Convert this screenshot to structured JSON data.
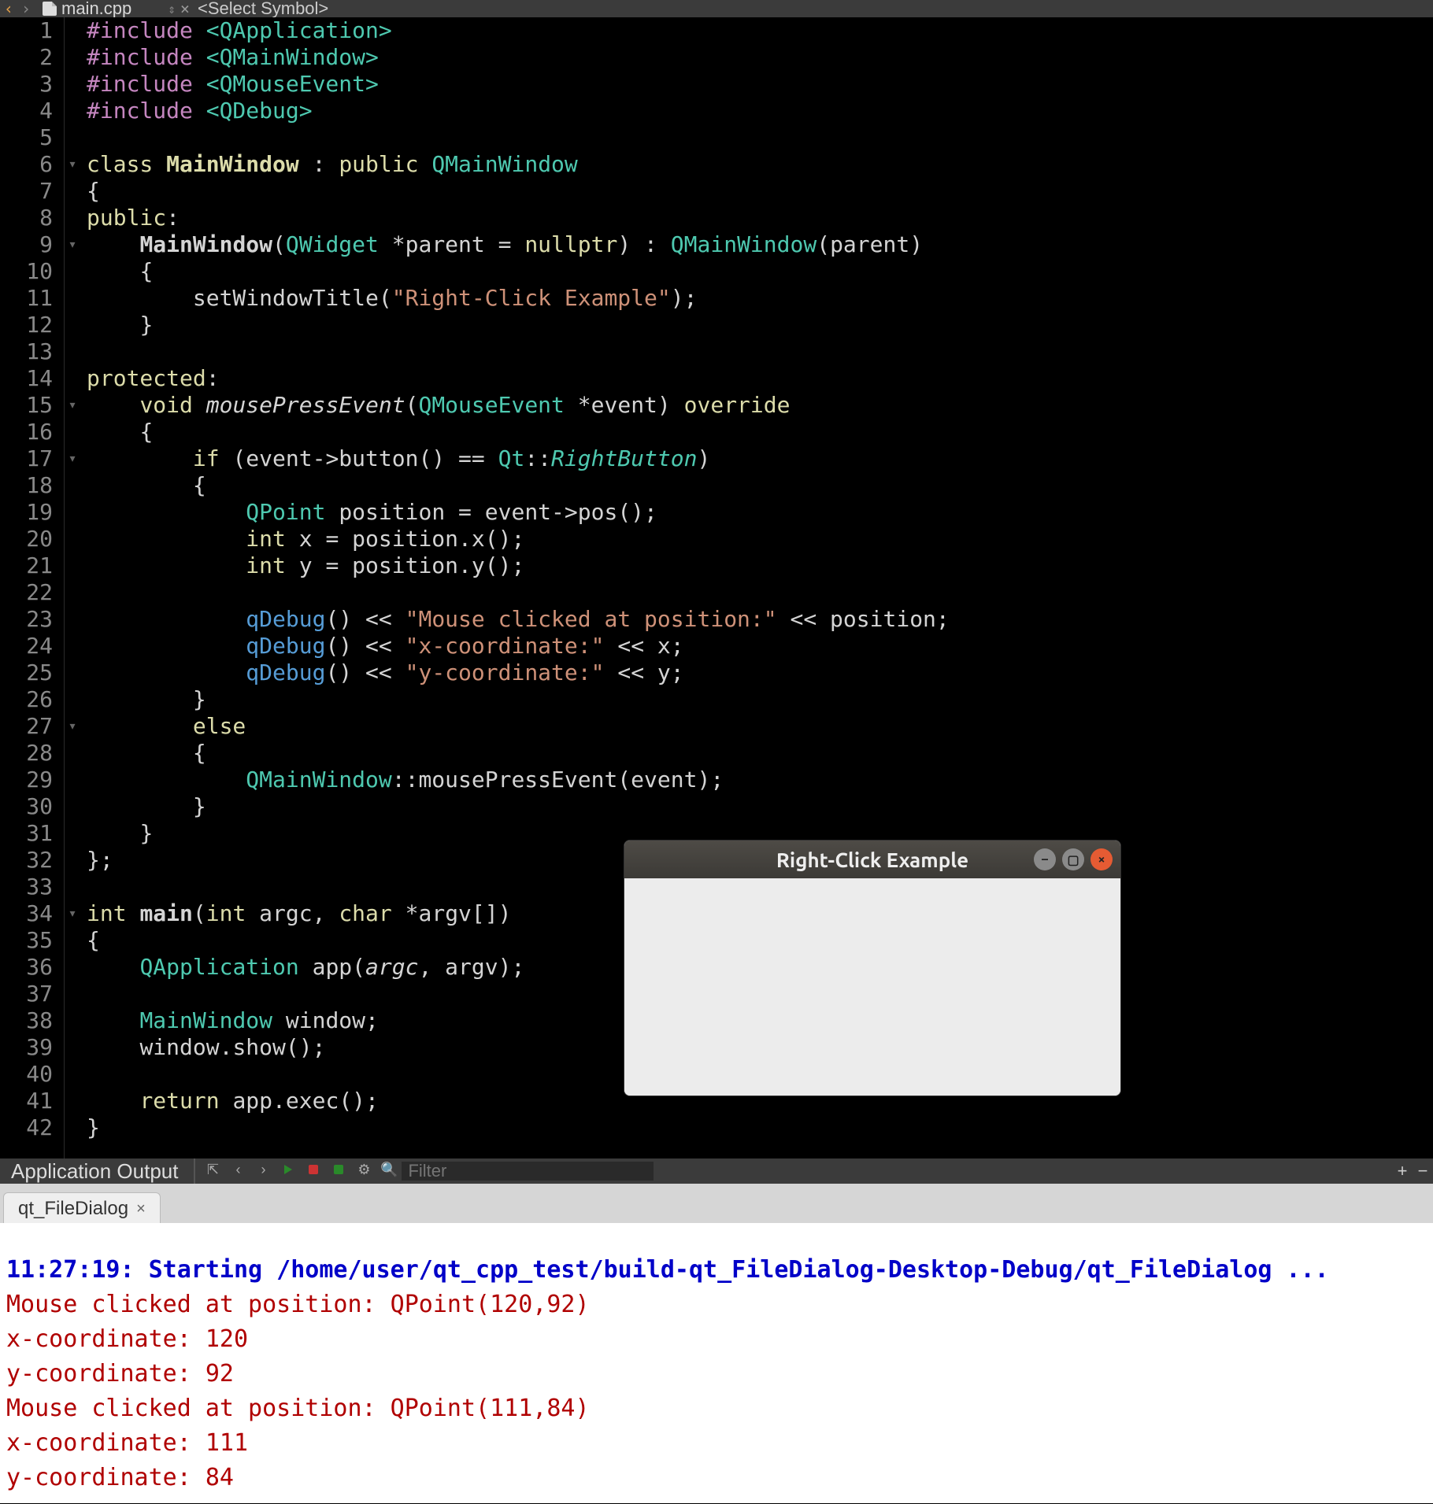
{
  "topbar": {
    "filename": "main.cpp",
    "symbol_selector": "<Select Symbol>"
  },
  "code_lines": [
    {
      "n": 1,
      "fold": "",
      "html": "<span class='kw-purple'>#include</span> <span class='hdr'>&lt;QApplication&gt;</span>"
    },
    {
      "n": 2,
      "fold": "",
      "html": "<span class='kw-purple'>#include</span> <span class='hdr'>&lt;QMainWindow&gt;</span>"
    },
    {
      "n": 3,
      "fold": "",
      "html": "<span class='kw-purple'>#include</span> <span class='hdr'>&lt;QMouseEvent&gt;</span>"
    },
    {
      "n": 4,
      "fold": "",
      "html": "<span class='kw-purple'>#include</span> <span class='hdr'>&lt;QDebug&gt;</span>"
    },
    {
      "n": 5,
      "fold": "",
      "html": ""
    },
    {
      "n": 6,
      "fold": "▾",
      "html": "<span class='kw-yellow'>class</span> <span class='kw-yellow' style='font-weight:600'>MainWindow</span> <span class='white'>:</span> <span class='kw-yellow'>public</span> <span class='type'>QMainWindow</span>"
    },
    {
      "n": 7,
      "fold": "",
      "html": "<span class='white'>{</span>"
    },
    {
      "n": 8,
      "fold": "",
      "html": "<span class='kw-yellow'>public</span><span class='white'>:</span>"
    },
    {
      "n": 9,
      "fold": "▾",
      "html": "    <span class='white' style='font-weight:600'>MainWindow</span><span class='white'>(</span><span class='type'>QWidget</span> <span class='white'>*parent = </span><span class='kw-yellow'>nullptr</span><span class='white'>) : </span><span class='type'>QMainWindow</span><span class='white'>(parent)</span>"
    },
    {
      "n": 10,
      "fold": "",
      "html": "    <span class='white'>{</span>"
    },
    {
      "n": 11,
      "fold": "",
      "html": "        <span class='white'>setWindowTitle(</span><span class='str'>\"Right-Click Example\"</span><span class='white'>);</span>"
    },
    {
      "n": 12,
      "fold": "",
      "html": "    <span class='white'>}</span>"
    },
    {
      "n": 13,
      "fold": "",
      "html": ""
    },
    {
      "n": 14,
      "fold": "",
      "html": "<span class='kw-yellow'>protected</span><span class='white'>:</span>"
    },
    {
      "n": 15,
      "fold": "▾",
      "html": "    <span class='kw-yellow'>void</span> <span class='white ital'>mousePressEvent</span><span class='white'>(</span><span class='type'>QMouseEvent</span> <span class='white'>*event) </span><span class='kw-yellow'>override</span>"
    },
    {
      "n": 16,
      "fold": "",
      "html": "    <span class='white'>{</span>"
    },
    {
      "n": 17,
      "fold": "▾",
      "html": "        <span class='kw-yellow'>if</span> <span class='white'>(event-&gt;button() == </span><span class='type'>Qt</span><span class='white'>::</span><span class='type ital'>RightButton</span><span class='white'>)</span>"
    },
    {
      "n": 18,
      "fold": "",
      "html": "        <span class='white'>{</span>"
    },
    {
      "n": 19,
      "fold": "",
      "html": "            <span class='type'>QPoint</span> <span class='white'>position = event-&gt;pos();</span>"
    },
    {
      "n": 20,
      "fold": "",
      "html": "            <span class='kw-yellow'>int</span> <span class='white'>x = position.x();</span>"
    },
    {
      "n": 21,
      "fold": "",
      "html": "            <span class='kw-yellow'>int</span> <span class='white'>y = position.y();</span>"
    },
    {
      "n": 22,
      "fold": "",
      "html": ""
    },
    {
      "n": 23,
      "fold": "",
      "html": "            <span class='kw-blue'>qDebug</span><span class='white'>() &lt;&lt; </span><span class='str'>\"Mouse clicked at position:\"</span><span class='white'> &lt;&lt; position;</span>"
    },
    {
      "n": 24,
      "fold": "",
      "html": "            <span class='kw-blue'>qDebug</span><span class='white'>() &lt;&lt; </span><span class='str'>\"x-coordinate:\"</span><span class='white'> &lt;&lt; x;</span>"
    },
    {
      "n": 25,
      "fold": "",
      "html": "            <span class='kw-blue'>qDebug</span><span class='white'>() &lt;&lt; </span><span class='str'>\"y-coordinate:\"</span><span class='white'> &lt;&lt; y;</span>"
    },
    {
      "n": 26,
      "fold": "",
      "html": "        <span class='white'>}</span>"
    },
    {
      "n": 27,
      "fold": "▾",
      "html": "        <span class='kw-yellow'>else</span>"
    },
    {
      "n": 28,
      "fold": "",
      "html": "        <span class='white'>{</span>"
    },
    {
      "n": 29,
      "fold": "",
      "html": "            <span class='type'>QMainWindow</span><span class='white'>::mousePressEvent(event);</span>"
    },
    {
      "n": 30,
      "fold": "",
      "html": "        <span class='white'>}</span>"
    },
    {
      "n": 31,
      "fold": "",
      "html": "    <span class='white'>}</span>"
    },
    {
      "n": 32,
      "fold": "",
      "html": "<span class='white'>};</span>"
    },
    {
      "n": 33,
      "fold": "",
      "html": ""
    },
    {
      "n": 34,
      "fold": "▾",
      "html": "<span class='kw-yellow'>int</span> <span class='white' style='font-weight:600'>main</span><span class='white'>(</span><span class='kw-yellow'>int</span> <span class='white'>argc, </span><span class='kw-yellow'>char</span> <span class='white'>*argv[])</span>"
    },
    {
      "n": 35,
      "fold": "",
      "html": "<span class='white'>{</span>"
    },
    {
      "n": 36,
      "fold": "",
      "html": "    <span class='type'>QApplication</span> <span class='white'>app(</span><span class='white ital'>argc</span><span class='white'>, argv);</span>"
    },
    {
      "n": 37,
      "fold": "",
      "html": ""
    },
    {
      "n": 38,
      "fold": "",
      "html": "    <span class='type'>MainWindow</span> <span class='white'>window;</span>"
    },
    {
      "n": 39,
      "fold": "",
      "html": "    <span class='white'>window.show();</span>"
    },
    {
      "n": 40,
      "fold": "",
      "html": ""
    },
    {
      "n": 41,
      "fold": "",
      "html": "    <span class='kw-yellow'>return</span> <span class='white'>app.exec();</span>"
    },
    {
      "n": 42,
      "fold": "",
      "html": "<span class='white'>}</span>"
    }
  ],
  "outbar": {
    "title": "Application Output",
    "filter_placeholder": "Filter"
  },
  "out_tab": {
    "label": "qt_FileDialog"
  },
  "output_lines": [
    {
      "cls": "out-blue",
      "text": "11:27:19: Starting /home/user/qt_cpp_test/build-qt_FileDialog-Desktop-Debug/qt_FileDialog ..."
    },
    {
      "cls": "out-red",
      "text": "Mouse clicked at position: QPoint(120,92)"
    },
    {
      "cls": "out-red",
      "text": "x-coordinate: 120"
    },
    {
      "cls": "out-red",
      "text": "y-coordinate: 92"
    },
    {
      "cls": "out-red",
      "text": "Mouse clicked at position: QPoint(111,84)"
    },
    {
      "cls": "out-red",
      "text": "x-coordinate: 111"
    },
    {
      "cls": "out-red",
      "text": "y-coordinate: 84"
    }
  ],
  "qt_window": {
    "title": "Right-Click Example"
  }
}
